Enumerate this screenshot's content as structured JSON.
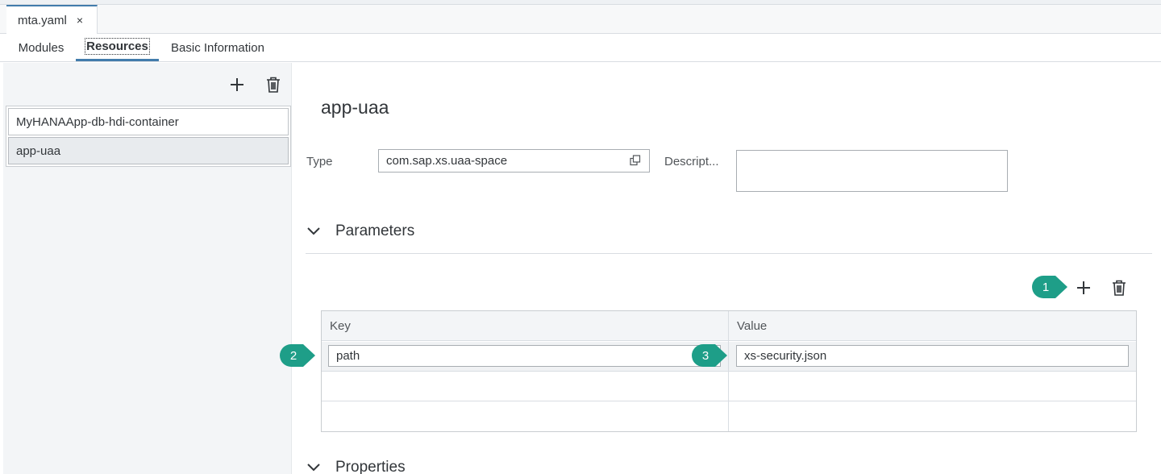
{
  "file_tab": {
    "label": "mta.yaml",
    "close_glyph": "×"
  },
  "editor_tabs": [
    {
      "label": "Modules",
      "active": false
    },
    {
      "label": "Resources",
      "active": true
    },
    {
      "label": "Basic Information",
      "active": false
    }
  ],
  "sidebar": {
    "items": [
      {
        "label": "MyHANAApp-db-hdi-container",
        "selected": false
      },
      {
        "label": "app-uaa",
        "selected": true
      }
    ]
  },
  "detail": {
    "title": "app-uaa",
    "type_label": "Type",
    "type_value": "com.sap.xs.uaa-space",
    "description_label": "Descript...",
    "description_value": ""
  },
  "parameters": {
    "heading": "Parameters",
    "columns": [
      "Key",
      "Value"
    ],
    "rows": [
      {
        "key": "path",
        "value": "xs-security.json"
      }
    ]
  },
  "properties": {
    "heading": "Properties"
  },
  "callouts": [
    "1",
    "2",
    "3"
  ],
  "colors": {
    "accent": "#427cac",
    "callout": "#1e9e88",
    "icon": "#32363a"
  }
}
